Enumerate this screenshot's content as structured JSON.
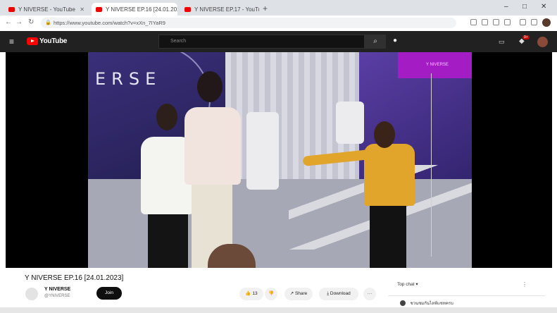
{
  "browser": {
    "tabs": [
      {
        "label": "Y NIVERSE - YouTube"
      },
      {
        "label": "Y NIVERSE EP.16 [24.01.2023]"
      },
      {
        "label": "Y NIVERSE EP.17 - YouTube"
      }
    ],
    "url": "https://www.youtube.com/watch?v=xXn_7IYaR9",
    "window_controls": [
      "–",
      "□",
      "✕"
    ]
  },
  "youtube": {
    "logo_text": "YouTube",
    "search_placeholder": "Search",
    "notification_count": "9+"
  },
  "video": {
    "title": "Y NIVERSE EP.16 [24.01.2023]",
    "overlay_wall_text": "ERSE",
    "overlay_badge_text": "Y NIVERSE"
  },
  "channel": {
    "name": "Y NIVERSE",
    "handle": "@YNIVERSE",
    "join_label": "Join"
  },
  "actions": {
    "likes": "13",
    "share_label": "Share",
    "download_label": "Download",
    "more_label": "···"
  },
  "chat": {
    "mode_label": "Top chat",
    "menu_label": "⋮",
    "message": "ชวนชมกันไลฟ์แชทครบ"
  }
}
